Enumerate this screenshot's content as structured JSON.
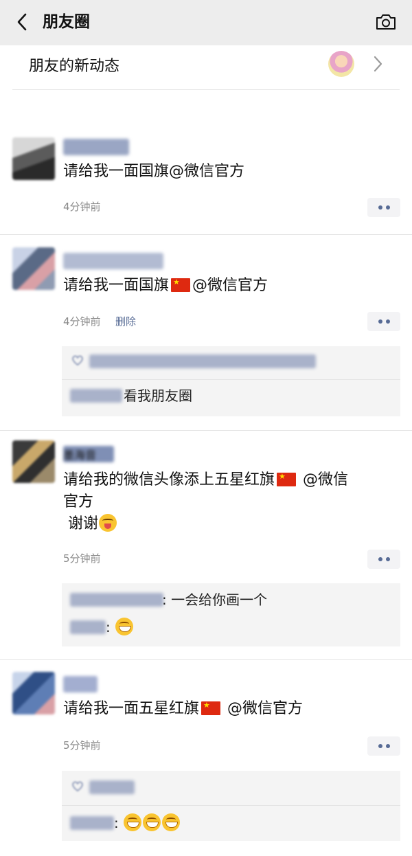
{
  "header": {
    "title": "朋友圈",
    "back_icon": "chevron-left-icon",
    "camera_icon": "camera-icon"
  },
  "new_updates": {
    "label": "朋友的新动态"
  },
  "posts": [
    {
      "text": "请给我一面国旗@微信官方",
      "time": "4分钟前"
    },
    {
      "text_before": "请给我一面国旗",
      "text_after": "@微信官方",
      "time": "4分钟前",
      "delete_label": "删除",
      "comment_text": "看我朋友圈"
    },
    {
      "name": "墨海音",
      "line1_before": "请给我的微信头像添上五星红旗",
      "line1_after": " @微信",
      "line2": "官方",
      "line3": " 谢谢",
      "time": "5分钟前",
      "comment1_text": ": 一会给你画一个",
      "comment2_sep": ":"
    },
    {
      "text_before": "请给我一面五星红旗",
      "text_after": " @微信官方",
      "time": "5分钟前",
      "comment_sep": ":"
    }
  ],
  "colors": {
    "link": "#576b95",
    "flag_red": "#de2910",
    "topbar_bg": "#ededed",
    "comment_bg": "#f4f4f4"
  }
}
